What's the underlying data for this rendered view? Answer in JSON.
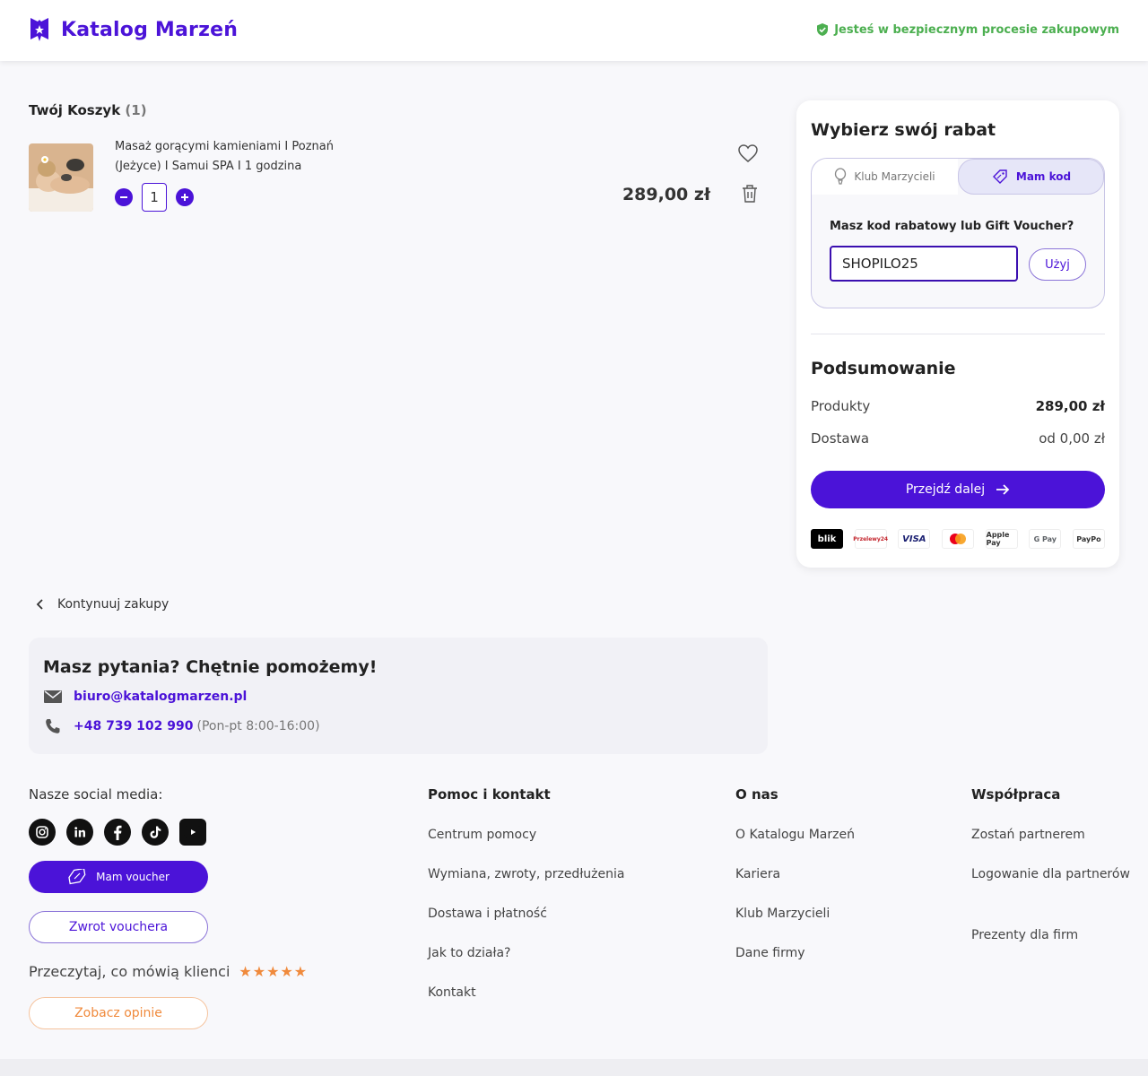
{
  "header": {
    "logo_text": "Katalog Marzeń",
    "secure_text": "Jesteś w bezpiecznym procesie zakupowym",
    "brand_color": "#4b13d8",
    "secure_color": "#4caf50"
  },
  "cart": {
    "title": "Twój Koszyk",
    "count": "(1)",
    "items": [
      {
        "name": "Masaż gorącymi kamieniami I Poznań (Jeżyce) I Samui SPA I 1 godzina",
        "quantity": "1",
        "price": "289,00 zł"
      }
    ]
  },
  "discount": {
    "title": "Wybierz swój rabat",
    "tab_club": "Klub Marzycieli",
    "tab_code": "Mam kod",
    "code_label": "Masz kod rabatowy lub Gift Voucher?",
    "code_value": "SHOPILO25",
    "use_button": "Użyj"
  },
  "summary": {
    "title": "Podsumowanie",
    "products_label": "Produkty",
    "products_value": "289,00 zł",
    "delivery_label": "Dostawa",
    "delivery_value": "od 0,00 zł",
    "proceed_button": "Przejdź dalej"
  },
  "payments": [
    "blik",
    "Przelewy24",
    "VISA",
    "mastercard",
    "Apple Pay",
    "G Pay",
    "PayPo"
  ],
  "continue_link": "Kontynuuj zakupy",
  "help": {
    "title": "Masz pytania? Chętnie pomożemy!",
    "email": "biuro@katalogmarzen.pl",
    "phone": "+48 739 102 990",
    "hours": "(Pon-pt 8:00-16:00)"
  },
  "footer": {
    "social_title": "Nasze social media:",
    "socials": [
      "instagram-icon",
      "linkedin-icon",
      "facebook-icon",
      "tiktok-icon",
      "youtube-icon"
    ],
    "voucher_button": "Mam voucher",
    "return_button": "Zwrot vouchera",
    "reviews_text": "Przeczytaj, co mówią klienci",
    "stars": "★★★★★",
    "opinions_button": "Zobacz opinie",
    "columns": [
      {
        "title": "Pomoc i kontakt",
        "links": [
          "Centrum pomocy",
          "Wymiana, zwroty, przedłużenia",
          "Dostawa i płatność",
          "Jak to działa?",
          "Kontakt"
        ]
      },
      {
        "title": "O nas",
        "links": [
          "O Katalogu Marzeń",
          "Kariera",
          "Klub Marzycieli",
          "Dane firmy"
        ]
      },
      {
        "title": "Współpraca",
        "links": [
          "Zostań partnerem",
          "Logowanie dla partnerów",
          "Prezenty dla firm"
        ]
      }
    ]
  }
}
